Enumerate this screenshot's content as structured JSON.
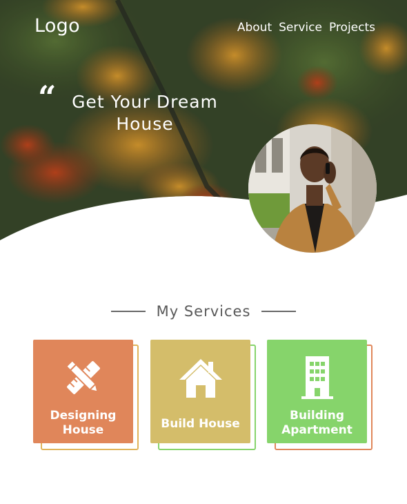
{
  "header": {
    "logo": "Logo",
    "nav": [
      "About",
      "Service",
      "Projects"
    ]
  },
  "hero": {
    "quote_mark": "“",
    "headline": "Get Your Dream House"
  },
  "services": {
    "title": "My Services",
    "cards": [
      {
        "label": "Designing House",
        "icon": "pencil-ruler-icon",
        "color": "#e0865a",
        "outline": "#e0b45a"
      },
      {
        "label": "Build House",
        "icon": "house-icon",
        "color": "#d4bd6a",
        "outline": "#86d46b"
      },
      {
        "label": "Building Apartment",
        "icon": "building-icon",
        "color": "#86d46b",
        "outline": "#e0865a"
      }
    ]
  }
}
